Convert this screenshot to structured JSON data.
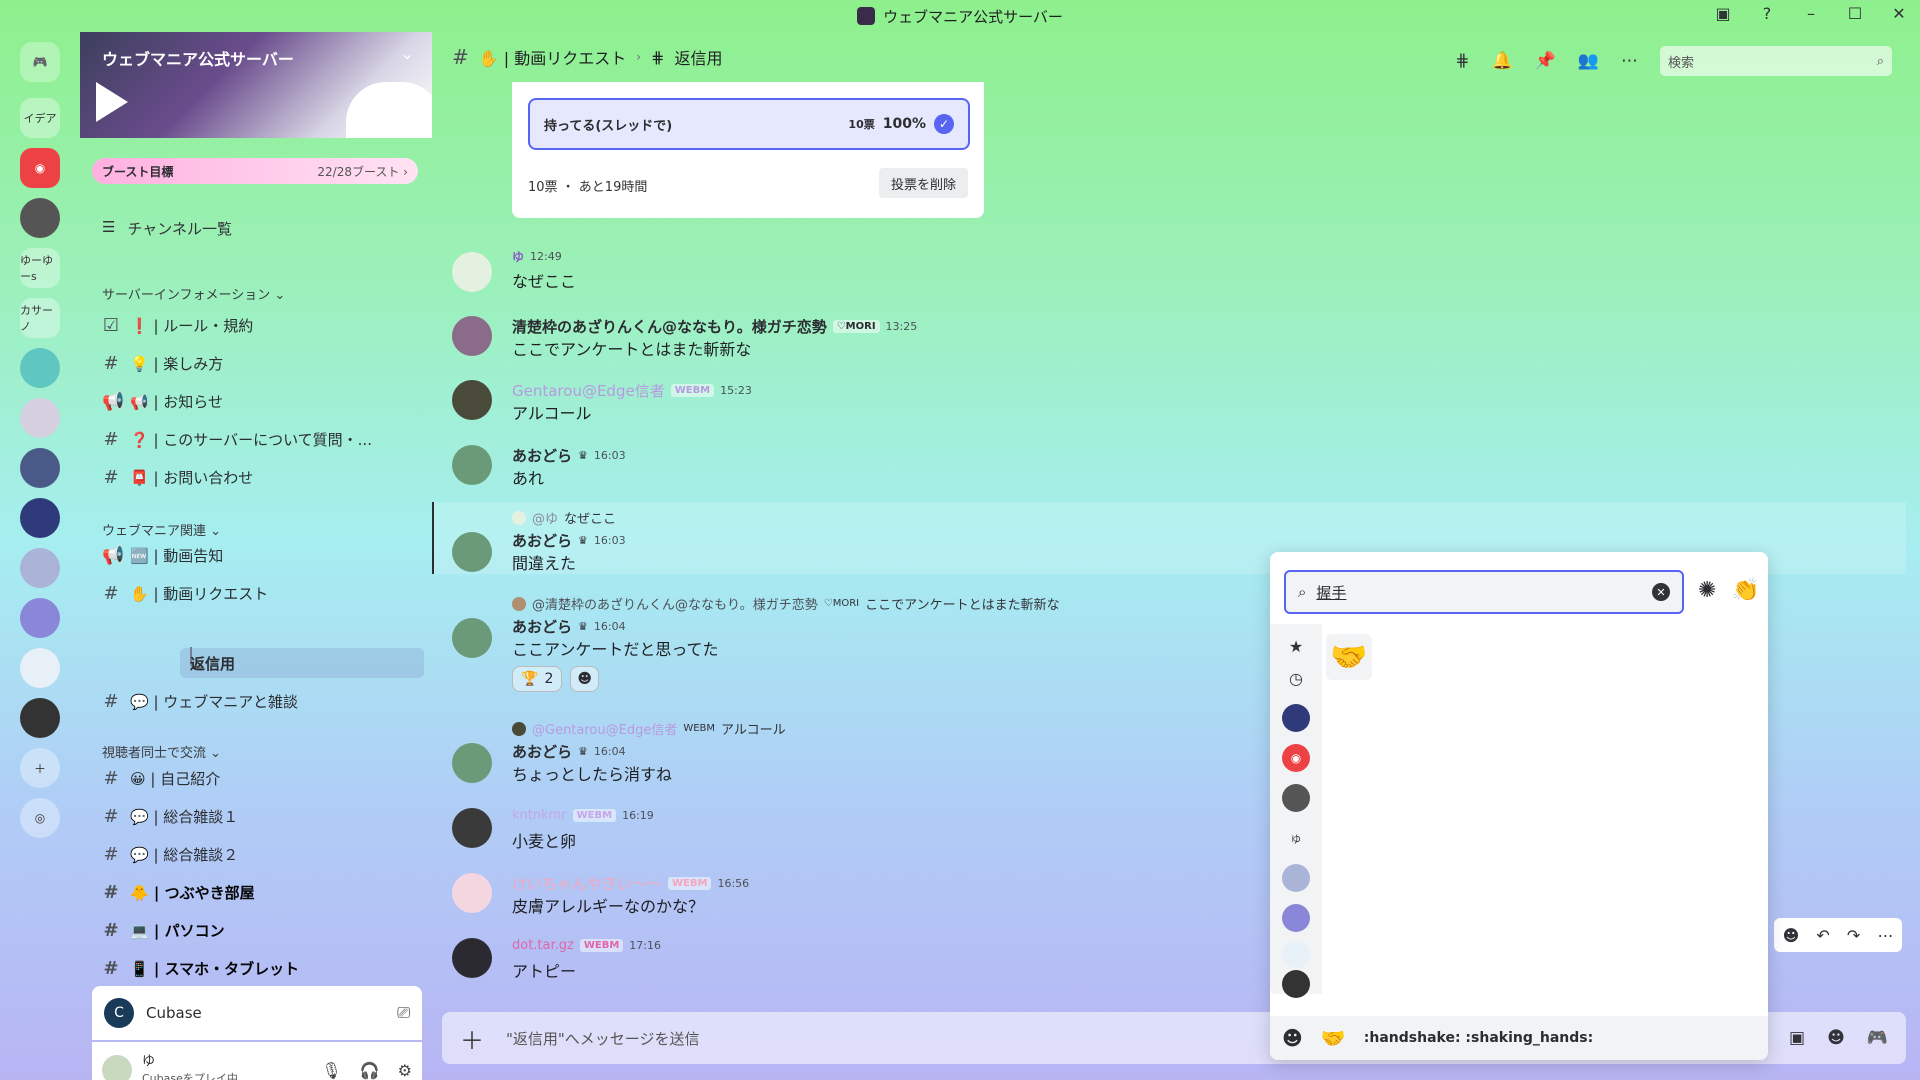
{
  "window": {
    "title": "ウェブマニア公式サーバー"
  },
  "guilds": {
    "items": [
      "イデア",
      "ゆーゆーs",
      "カサーノ"
    ]
  },
  "server": {
    "name": "ウェブマニア公式サーバー",
    "boost_label": "ブースト目標",
    "boost_count": "22/28ブースト ›",
    "channel_browser": "チャンネル一覧"
  },
  "categories": [
    {
      "label": "サーバーインフォメーション ⌄"
    },
    {
      "label": "ウェブマニア関連 ⌄"
    },
    {
      "label": "視聴者同士で交流 ⌄"
    }
  ],
  "channels": [
    {
      "label": "❗ | ルール・規約"
    },
    {
      "label": "💡 | 楽しみ方"
    },
    {
      "label": "📢 | お知らせ"
    },
    {
      "label": "❓ | このサーバーについて質問・..."
    },
    {
      "label": "📮 | お問い合わせ"
    },
    {
      "label": "🆕 | 動画告知"
    },
    {
      "label": "✋ | 動画リクエスト"
    },
    {
      "label": "返信用"
    },
    {
      "label": "💬 | ウェブマニアと雑談"
    },
    {
      "label": "😀 | 自己紹介"
    },
    {
      "label": "💬 | 総合雑談１"
    },
    {
      "label": "💬 | 総合雑談２"
    },
    {
      "label": "🐥 | つぶやき部屋"
    },
    {
      "label": "💻 | パソコン"
    },
    {
      "label": "📱 | スマホ・タブレット"
    }
  ],
  "activity": {
    "app": "Cubase"
  },
  "user": {
    "name": "ゆ",
    "status": "Cubaseをプレイ中"
  },
  "topbar": {
    "channel": "✋ | 動画リクエスト",
    "thread": "返信用",
    "search_placeholder": "検索"
  },
  "poll": {
    "option": "持ってる(スレッドで)",
    "votes": "10票",
    "percent": "100%",
    "footer": "10票 ・ あと19時間",
    "remove": "投票を削除"
  },
  "messages": [
    {
      "name": "ゆ",
      "tag": "",
      "time": "12:49",
      "text": "なぜここ"
    },
    {
      "name": "清楚枠のあざりんくん@ななもり。様ガチ恋勢",
      "tag": "♡MORI",
      "time": "13:25",
      "text": "ここでアンケートとはまた斬新な"
    },
    {
      "name": "Gentarou@Edge信者",
      "tag": "WEBM",
      "time": "15:23",
      "text": "アルコール"
    },
    {
      "name": "あおどら",
      "tag": "",
      "time": "16:03",
      "text": "あれ"
    },
    {
      "name": "あおどら",
      "tag": "",
      "time": "16:03",
      "text": "間違えた",
      "reply_name": "@ゆ",
      "reply_text": "なぜここ"
    },
    {
      "name": "あおどら",
      "tag": "",
      "time": "16:04",
      "text": "ここアンケートだと思ってた",
      "reply_name": "@清楚枠のあざりんくん@ななもり。様ガチ恋勢",
      "reply_tag": "♡MORI",
      "reply_text": "ここでアンケートとはまた斬新な",
      "reaction_count": "2"
    },
    {
      "name": "あおどら",
      "tag": "",
      "time": "16:04",
      "text": "ちょっとしたら消すね",
      "reply_name": "@Gentarou@Edge信者",
      "reply_tag": "WEBM",
      "reply_text": "アルコール"
    },
    {
      "name": "kntnkmr",
      "tag": "WEBM",
      "time": "16:19",
      "text": "小麦と卵"
    },
    {
      "name": "けいちゃんやきい〜〜",
      "tag": "WEBM",
      "time": "16:56",
      "text": "皮膚アレルギーなのかな？"
    },
    {
      "name": "dot.tar.gz",
      "tag": "WEBM",
      "time": "17:16",
      "text": "アトピー"
    }
  ],
  "composer": {
    "placeholder": "\"返信用\"へメッセージを送信"
  },
  "emoji_picker": {
    "query": "握手",
    "result": "🤝",
    "footer_name": ":handshake: :shaking_hands:"
  },
  "colors": {
    "accent": "#5865f2",
    "gentarou": "#b79be0",
    "kntnkmr": "#c6a6e6",
    "kei": "#f4a6c0",
    "dot": "#e066a8"
  }
}
